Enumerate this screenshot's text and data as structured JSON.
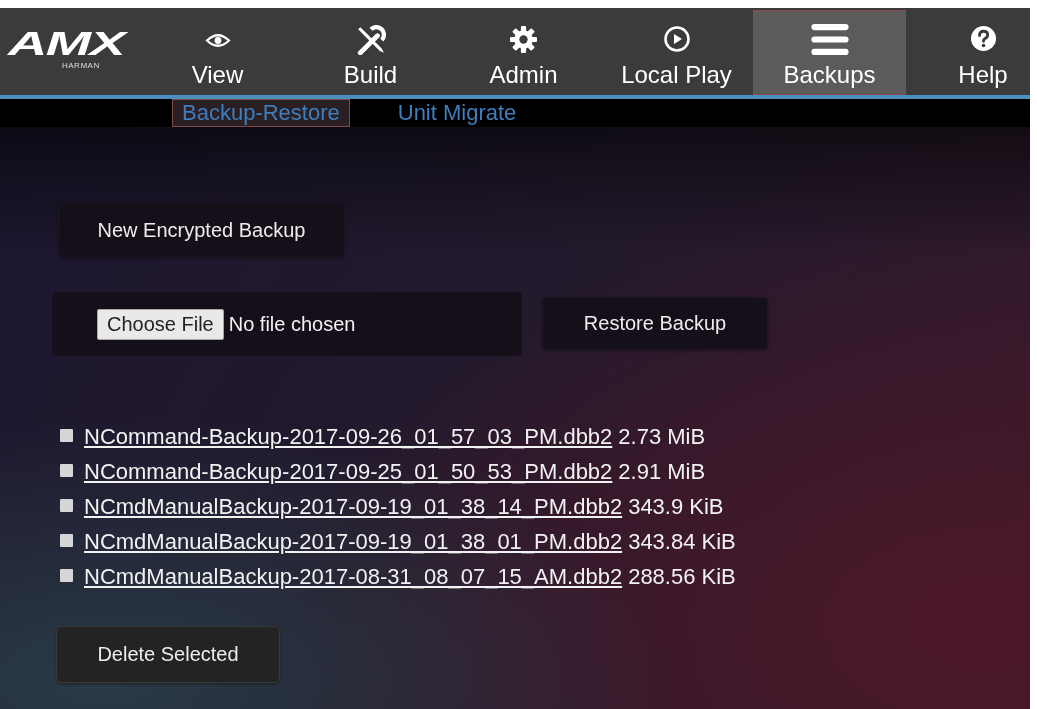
{
  "nav": {
    "logo": {
      "brand": "AMX",
      "maker": "HARMAN"
    },
    "items": [
      {
        "label": "View",
        "selected": false
      },
      {
        "label": "Build",
        "selected": false
      },
      {
        "label": "Admin",
        "selected": false
      },
      {
        "label": "Local Play",
        "selected": false
      },
      {
        "label": "Backups",
        "selected": true
      },
      {
        "label": "Help",
        "selected": false
      }
    ]
  },
  "subnav": [
    {
      "label": "Backup-Restore",
      "selected": true
    },
    {
      "label": "Unit Migrate",
      "selected": false
    }
  ],
  "new_backup_button": "New Encrypted Backup",
  "file_input": {
    "button": "Choose File",
    "status": "No file chosen"
  },
  "restore_button": "Restore Backup",
  "backups": [
    {
      "file": "NCommand-Backup-2017-09-26_01_57_03_PM.dbb2",
      "size": "2.73 MiB",
      "checked": false
    },
    {
      "file": "NCommand-Backup-2017-09-25_01_50_53_PM.dbb2",
      "size": "2.91 MiB",
      "checked": false
    },
    {
      "file": "NCmdManualBackup-2017-09-19_01_38_14_PM.dbb2",
      "size": "343.9 KiB",
      "checked": false
    },
    {
      "file": "NCmdManualBackup-2017-09-19_01_38_01_PM.dbb2",
      "size": "343.84 KiB",
      "checked": false
    },
    {
      "file": "NCmdManualBackup-2017-08-31_08_07_15_AM.dbb2",
      "size": "288.56 KiB",
      "checked": false
    }
  ],
  "delete_button": "Delete Selected"
}
